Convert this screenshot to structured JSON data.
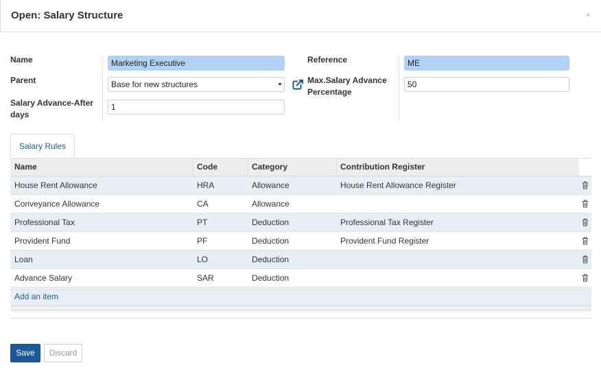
{
  "dialog": {
    "title": "Open: Salary Structure",
    "close_glyph": "×"
  },
  "form": {
    "name_label": "Name",
    "name_value": "Marketing Executive",
    "parent_label": "Parent",
    "parent_value": "Base for new structures",
    "salary_advance_label": "Salary Advance-After days",
    "salary_advance_value": "1",
    "reference_label": "Reference",
    "reference_value": "ME",
    "max_advance_label": "Max.Salary Advance Percentage",
    "max_advance_value": "50",
    "external_link_icon": "external-link-icon"
  },
  "tabs": [
    {
      "label": "Salary Rules"
    }
  ],
  "grid": {
    "columns": [
      "Name",
      "Code",
      "Category",
      "Contribution Register"
    ],
    "rows": [
      {
        "name": "House Rent Allowance",
        "code": "HRA",
        "category": "Allowance",
        "register": "House Rent Allowance Register"
      },
      {
        "name": "Conveyance Allowance",
        "code": "CA",
        "category": "Allowance",
        "register": ""
      },
      {
        "name": "Professional Tax",
        "code": "PT",
        "category": "Deduction",
        "register": "Professional Tax Register"
      },
      {
        "name": "Provident Fund",
        "code": "PF",
        "category": "Deduction",
        "register": "Provident Fund Register"
      },
      {
        "name": "Loan",
        "code": "LO",
        "category": "Deduction",
        "register": ""
      },
      {
        "name": "Advance Salary",
        "code": "SAR",
        "category": "Deduction",
        "register": ""
      }
    ],
    "row_action_icon": "trash-icon",
    "add_item_label": "Add an item"
  },
  "footer": {
    "save_label": "Save",
    "discard_label": "Discard"
  },
  "colors": {
    "accent": "#1a5a9a",
    "required_field": "#b2d2f5",
    "row_highlight": "#e8eef5",
    "link": "#1b5e93"
  }
}
